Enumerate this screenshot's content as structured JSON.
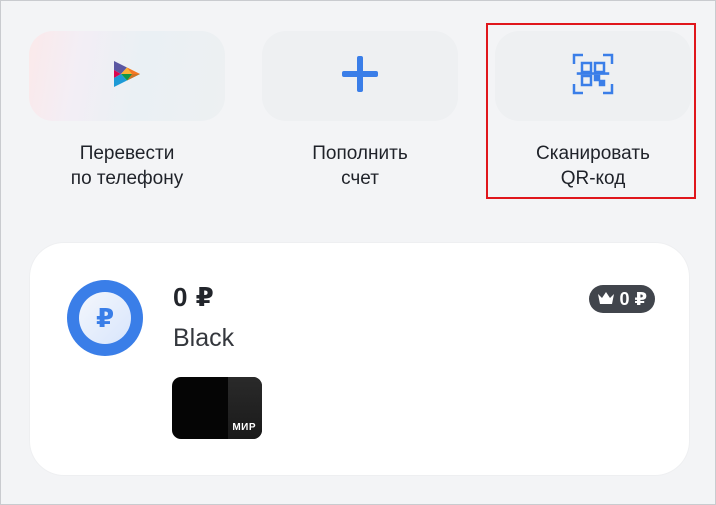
{
  "quick_actions": [
    {
      "label": "Перевести\nпо телефону",
      "icon": "sbp-transfer-icon"
    },
    {
      "label": "Пополнить\nсчет",
      "icon": "plus-icon"
    },
    {
      "label": "Сканировать\nQR-код",
      "icon": "qr-scan-icon"
    }
  ],
  "account": {
    "balance": "0 ₽",
    "name": "Black",
    "bonus": "0 ₽",
    "coin_symbol": "₽",
    "card_brand": "МИР"
  },
  "colors": {
    "accent_blue": "#3a7ee8",
    "highlight_red": "#e0161c",
    "pill_dark": "#41454c"
  }
}
